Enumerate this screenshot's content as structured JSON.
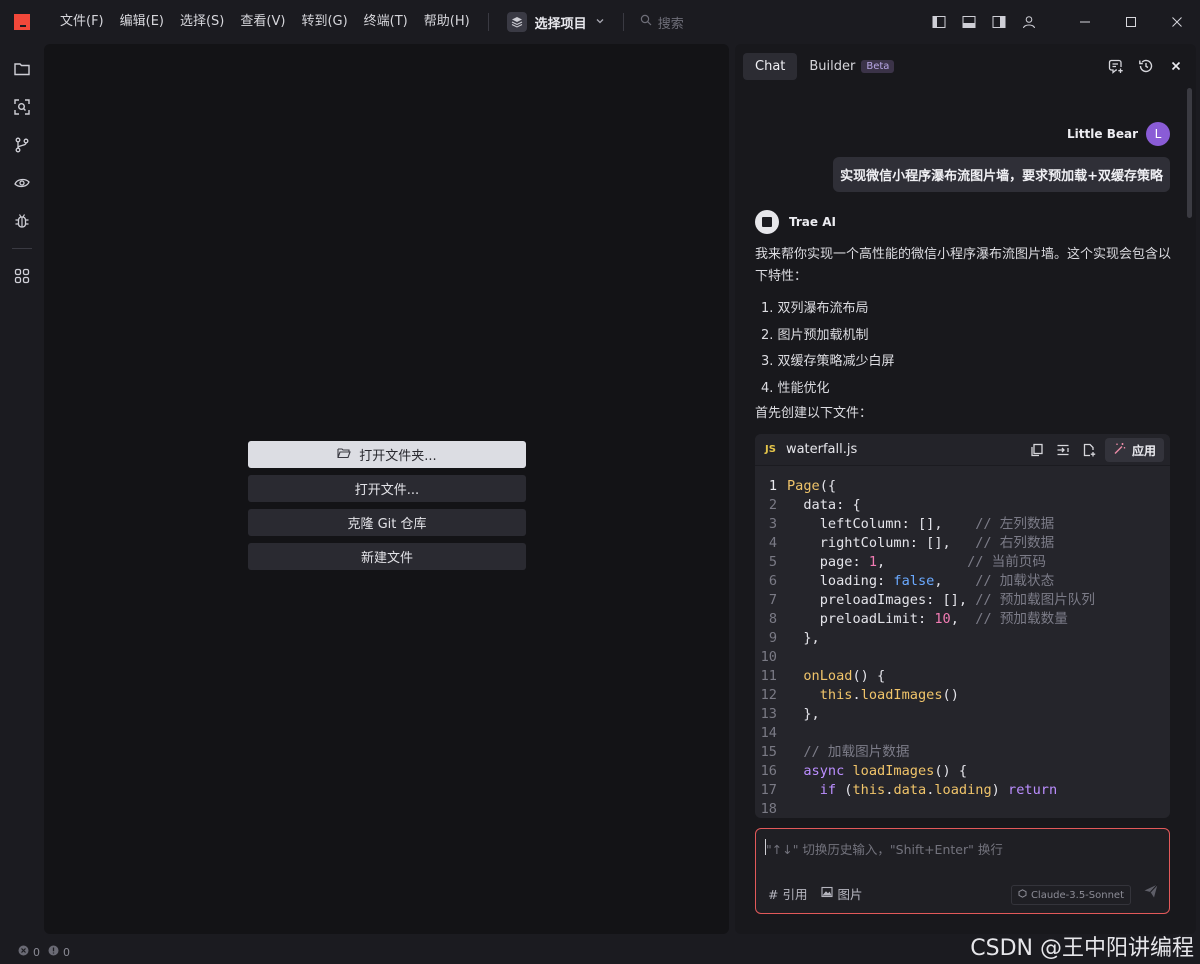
{
  "menu": [
    "文件(F)",
    "编辑(E)",
    "选择(S)",
    "查看(V)",
    "转到(G)",
    "终端(T)",
    "帮助(H)"
  ],
  "project": {
    "label": "选择项目"
  },
  "search": {
    "placeholder": "搜索"
  },
  "welcome": {
    "open_folder": "打开文件夹...",
    "open_file": "打开文件...",
    "clone_git": "克隆 Git 仓库",
    "new_file": "新建文件"
  },
  "chat": {
    "tabs": {
      "chat": "Chat",
      "builder": "Builder",
      "beta": "Beta"
    },
    "user": {
      "name": "Little Bear",
      "initial": "L",
      "message": "实现微信小程序瀑布流图片墙，要求预加载+双缓存策略"
    },
    "ai": {
      "name": "Trae AI",
      "intro": "我来帮你实现一个高性能的微信小程序瀑布流图片墙。这个实现会包含以下特性：",
      "features": [
        "1. 双列瀑布流布局",
        "2. 图片预加载机制",
        "3. 双缓存策略减少白屏",
        "4. 性能优化"
      ],
      "outro": "首先创建以下文件："
    },
    "code": {
      "badge": "JS",
      "filename": "waterfall.js",
      "apply_label": "应用",
      "line_numbers": [
        "1",
        "2",
        "3",
        "4",
        "5",
        "6",
        "7",
        "8",
        "9",
        "10",
        "11",
        "12",
        "13",
        "14",
        "15",
        "16",
        "17",
        "18"
      ]
    },
    "input": {
      "placeholder": "\"↑↓\" 切换历史输入，\"Shift+Enter\" 换行",
      "ref_label": "# 引用",
      "image_label": "图片",
      "model": "Claude-3.5-Sonnet"
    }
  },
  "status": {
    "errors": "0",
    "warnings": "0"
  },
  "watermark": "CSDN @王中阳讲编程",
  "colors": {
    "accent": "#e2595a",
    "logo": "#f2483a",
    "avatar": "#8a5cd6"
  }
}
